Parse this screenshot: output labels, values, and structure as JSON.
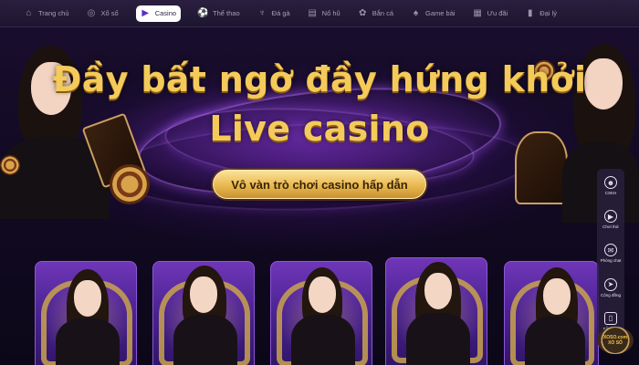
{
  "nav": {
    "items": [
      {
        "label": "Trang chủ",
        "icon": "home-icon",
        "glyph": "⌂",
        "active": false
      },
      {
        "label": "Xổ số",
        "icon": "lottery-icon",
        "glyph": "◎",
        "active": false
      },
      {
        "label": "Casino",
        "icon": "casino-icon",
        "glyph": "▶",
        "active": true
      },
      {
        "label": "Thể thao",
        "icon": "soccer-ball-icon",
        "glyph": "⚽",
        "active": false
      },
      {
        "label": "Đá gà",
        "icon": "rooster-icon",
        "glyph": "♆",
        "active": false
      },
      {
        "label": "Nổ hũ",
        "icon": "slot-machine-icon",
        "glyph": "▤",
        "active": false
      },
      {
        "label": "Bắn cá",
        "icon": "fish-icon",
        "glyph": "✿",
        "active": false
      },
      {
        "label": "Game bài",
        "icon": "cards-icon",
        "glyph": "♠",
        "active": false
      },
      {
        "label": "Ưu đãi",
        "icon": "gift-icon",
        "glyph": "▦",
        "active": false
      },
      {
        "label": "Đại lý",
        "icon": "agent-icon",
        "glyph": "▮",
        "active": false
      }
    ]
  },
  "hero": {
    "headline_line1": "Đầy bất ngờ đầy hứng khởi",
    "headline_line2": "Live casino",
    "cta_label": "Vô vàn trò chơi casino hấp dẫn",
    "accent_color": "#f4cb5a"
  },
  "sidebar": {
    "items": [
      {
        "label": "CSKH",
        "icon": "support-agent-icon",
        "glyph": "☻"
      },
      {
        "label": "Chơi thử",
        "icon": "play-icon",
        "glyph": "▶"
      },
      {
        "label": "Phòng chat",
        "icon": "chat-icon",
        "glyph": "✉"
      },
      {
        "label": "Cộng đồng",
        "icon": "send-icon",
        "glyph": "➤"
      },
      {
        "label": "TẢI APP",
        "icon": "app-download-icon",
        "glyph": "▯"
      }
    ],
    "logo_text": "XOSO.com",
    "logo_sub": "XỔ SỐ"
  }
}
